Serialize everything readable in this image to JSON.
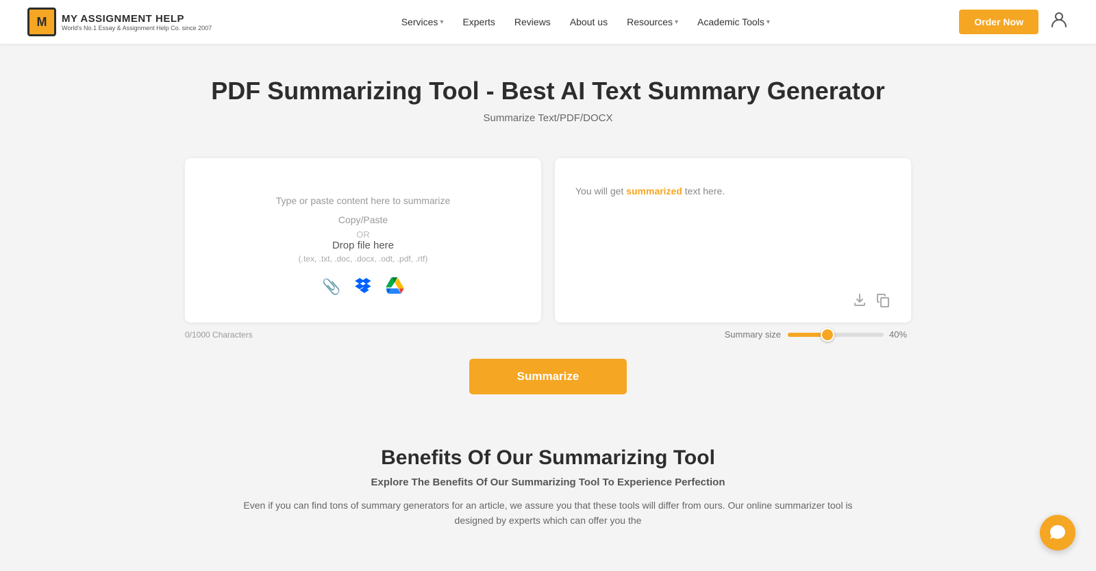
{
  "logo": {
    "badge": "M",
    "title": "MY ASSIGNMENT HELP",
    "subtitle": "World's No.1 Essay & Assignment Help Co. since 2007"
  },
  "nav": {
    "items": [
      {
        "label": "Services",
        "has_dropdown": true
      },
      {
        "label": "Experts",
        "has_dropdown": false
      },
      {
        "label": "Reviews",
        "has_dropdown": false
      },
      {
        "label": "About us",
        "has_dropdown": false
      },
      {
        "label": "Resources",
        "has_dropdown": true
      },
      {
        "label": "Academic Tools",
        "has_dropdown": true
      }
    ],
    "cta": "Order Now"
  },
  "hero": {
    "title": "PDF Summarizing Tool - Best AI Text Summary Generator",
    "subtitle": "Summarize Text/PDF/DOCX"
  },
  "input_panel": {
    "placeholder": "Type or paste content here to summarize",
    "copy_paste": "Copy/Paste",
    "or": "OR",
    "drop_file": "Drop file here",
    "file_types": "(.tex, .txt, .doc, .docx, .odt, .pdf, .rtf)"
  },
  "output_panel": {
    "text_before": "You will get ",
    "highlighted": "summarized",
    "text_after": " text here."
  },
  "controls": {
    "char_count": "0/1000 Characters",
    "summary_size_label": "Summary size",
    "percent": "40%",
    "slider_value": 40
  },
  "summarize_button": "Summarize",
  "benefits": {
    "title": "Benefits Of Our Summarizing Tool",
    "subtitle": "Explore The Benefits Of Our Summarizing Tool To Experience Perfection",
    "description": "Even if you can find tons of summary generators for an article, we assure you that these tools will differ from ours. Our online summarizer tool is designed by experts which can offer you the"
  },
  "icons": {
    "upload_clip": "📎",
    "download": "⬇",
    "copy": "⊞",
    "chat": "💬"
  },
  "colors": {
    "accent": "#f5a623",
    "dark": "#2d2d2d"
  }
}
